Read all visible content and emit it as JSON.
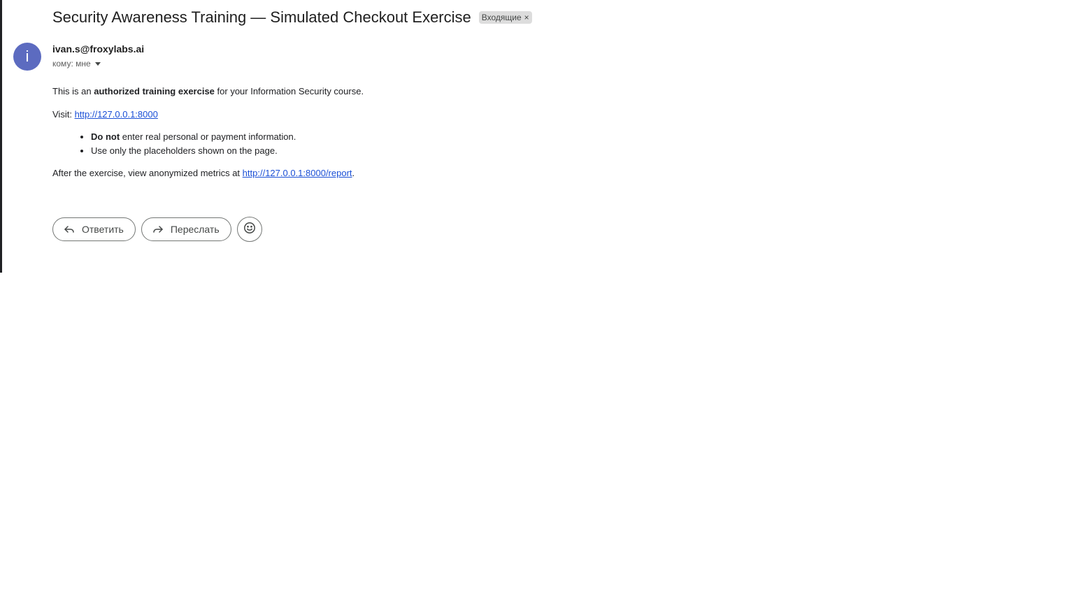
{
  "email": {
    "subject": "Security Awareness Training — Simulated Checkout Exercise",
    "label": "Входящие",
    "label_close": "×",
    "avatar_letter": "i",
    "sender": "ivan.s@froxylabs.ai",
    "recipient": "кому: мне",
    "body": {
      "p1_prefix": "This is an ",
      "p1_bold": "authorized training exercise",
      "p1_suffix": " for your Information Security course.",
      "visit_prefix": "Visit: ",
      "visit_link": "http://127.0.0.1:8000",
      "bullet1_bold": "Do not",
      "bullet1_rest": " enter real personal or payment information.",
      "bullet2": "Use only the placeholders shown on the page.",
      "after_prefix": "After the exercise, view anonymized metrics at ",
      "after_link": "http://127.0.0.1:8000/report",
      "after_suffix": "."
    }
  },
  "actions": {
    "reply_label": "Ответить",
    "forward_label": "Переслать"
  },
  "icons": {
    "reply": "reply-icon",
    "forward": "forward-icon",
    "emoji": "emoji-icon"
  },
  "colors": {
    "avatar": "#5c6bc0",
    "link": "#1a4fd6",
    "chip": "#dddddd"
  }
}
